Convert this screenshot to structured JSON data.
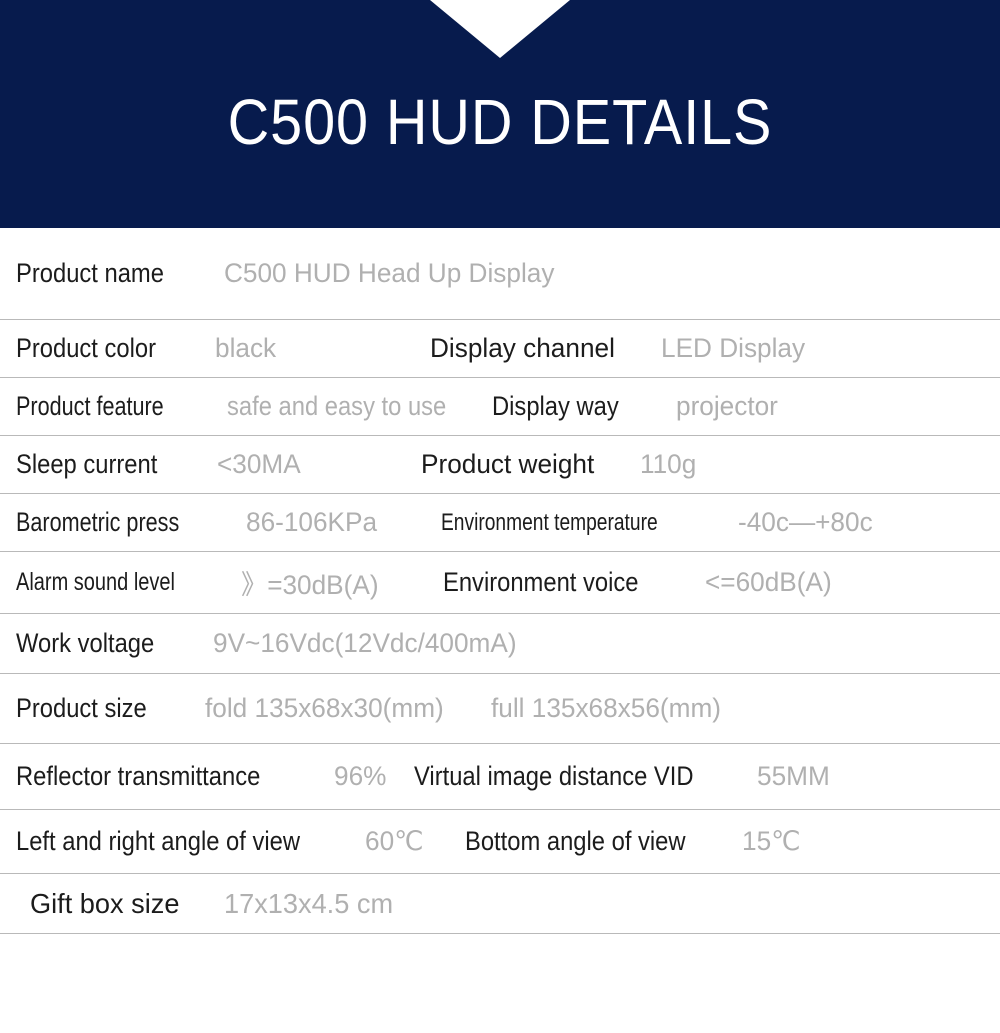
{
  "banner": {
    "title": "C500 HUD DETAILS",
    "background_color": "#071B4D",
    "notch_color": "#FFFFFF",
    "title_color": "#FFFFFF"
  },
  "colors": {
    "label_text": "#1C1C1C",
    "value_text": "#B0B0B0",
    "rule": "#B9B9B9",
    "page_background": "#FFFFFF"
  },
  "spec_table": {
    "rows": [
      {
        "label_1": "Product name",
        "value_1": "C500 HUD Head Up Display",
        "label_2": "",
        "value_2": ""
      },
      {
        "label_1": "Product color",
        "value_1": "black",
        "label_2": "Display channel",
        "value_2": "LED Display"
      },
      {
        "label_1": "Product feature",
        "value_1": "safe and easy to use",
        "label_2": "Display way",
        "value_2": "projector"
      },
      {
        "label_1": "Sleep current",
        "value_1": "<30MA",
        "label_2": "Product weight",
        "value_2": "110g"
      },
      {
        "label_1": "Barometric press",
        "value_1": "86-106KPa",
        "label_2": "Environment temperature",
        "value_2": "-40c—+80c"
      },
      {
        "label_1": "Alarm sound level",
        "value_1": "》=30dB(A)",
        "label_2": "Environment voice",
        "value_2": "<=60dB(A)"
      },
      {
        "label_1": "Work voltage",
        "value_1": "9V~16Vdc(12Vdc/400mA)",
        "label_2": "",
        "value_2": ""
      },
      {
        "label_1": "Product size",
        "value_1": "fold  135x68x30(mm)",
        "label_2": "",
        "value_2": "full 135x68x56(mm)"
      },
      {
        "label_1": "Reflector transmittance",
        "value_1": "96%",
        "label_2": "Virtual image distance VID",
        "value_2": "55MM"
      },
      {
        "label_1": "Left and right angle of view",
        "value_1": "60℃",
        "label_2": "Bottom angle of view",
        "value_2": "15℃"
      },
      {
        "label_1": "Gift box size",
        "value_1": "17x13x4.5 cm",
        "label_2": "",
        "value_2": ""
      }
    ]
  }
}
